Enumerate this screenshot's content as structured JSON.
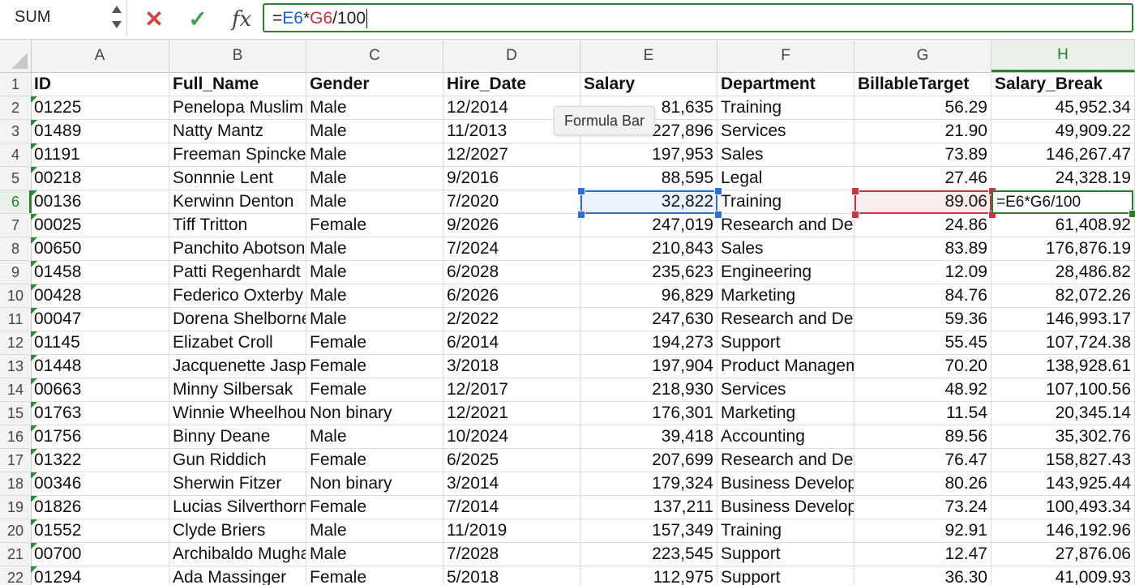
{
  "name_box": {
    "value": "SUM"
  },
  "formula_bar": {
    "cancel_glyph": "✕",
    "enter_glyph": "✓",
    "fx_label": "fx",
    "formula_parts": [
      {
        "text": "=",
        "ref": ""
      },
      {
        "text": "E6",
        "ref": "blue"
      },
      {
        "text": "*",
        "ref": ""
      },
      {
        "text": "G6",
        "ref": "red"
      },
      {
        "text": "/100",
        "ref": ""
      }
    ]
  },
  "tooltip": {
    "text": "Formula Bar"
  },
  "columns": [
    "A",
    "B",
    "C",
    "D",
    "E",
    "F",
    "G",
    "H"
  ],
  "active_column": "H",
  "active_row": 6,
  "header_row": [
    "ID",
    "Full_Name",
    "Gender",
    "Hire_Date",
    "Salary",
    "Department",
    "BillableTarget",
    "Salary_Break"
  ],
  "rows": [
    [
      "01225",
      "Penelopa Muslim",
      "Male",
      "12/2014",
      "81,635",
      "Training",
      "56.29",
      "45,952.34"
    ],
    [
      "01489",
      "Natty Mantz",
      "Male",
      "11/2013",
      "227,896",
      "Services",
      "21.90",
      "49,909.22"
    ],
    [
      "01191",
      "Freeman Spinckes",
      "Male",
      "12/2027",
      "197,953",
      "Sales",
      "73.89",
      "146,267.47"
    ],
    [
      "00218",
      "Sonnnie Lent",
      "Male",
      "9/2016",
      "88,595",
      "Legal",
      "27.46",
      "24,328.19"
    ],
    [
      "00136",
      "Kerwinn Denton",
      "Male",
      "7/2020",
      "32,822",
      "Training",
      "89.06",
      "=E6*G6/100"
    ],
    [
      "00025",
      "Tiff Tritton",
      "Female",
      "9/2026",
      "247,019",
      "Research and Development",
      "24.86",
      "61,408.92"
    ],
    [
      "00650",
      "Panchito Abotson",
      "Male",
      "7/2024",
      "210,843",
      "Sales",
      "83.89",
      "176,876.19"
    ],
    [
      "01458",
      "Patti Regenhardt",
      "Male",
      "6/2028",
      "235,623",
      "Engineering",
      "12.09",
      "28,486.82"
    ],
    [
      "00428",
      "Federico Oxterby",
      "Male",
      "6/2026",
      "96,829",
      "Marketing",
      "84.76",
      "82,072.26"
    ],
    [
      "00047",
      "Dorena Shelborne",
      "Male",
      "2/2022",
      "247,630",
      "Research and Development",
      "59.36",
      "146,993.17"
    ],
    [
      "01145",
      "Elizabet Croll",
      "Female",
      "6/2014",
      "194,273",
      "Support",
      "55.45",
      "107,724.38"
    ],
    [
      "01448",
      "Jacquenette Jaspar",
      "Female",
      "3/2018",
      "197,904",
      "Product Management",
      "70.20",
      "138,928.61"
    ],
    [
      "00663",
      "Minny Silbersak",
      "Female",
      "12/2017",
      "218,930",
      "Services",
      "48.92",
      "107,100.56"
    ],
    [
      "01763",
      "Winnie Wheelhouse",
      "Non binary",
      "12/2021",
      "176,301",
      "Marketing",
      "11.54",
      "20,345.14"
    ],
    [
      "01756",
      "Binny Deane",
      "Male",
      "10/2024",
      "39,418",
      "Accounting",
      "89.56",
      "35,302.76"
    ],
    [
      "01322",
      "Gun Riddich",
      "Female",
      "6/2025",
      "207,699",
      "Research and Development",
      "76.47",
      "158,827.43"
    ],
    [
      "00346",
      "Sherwin Fitzer",
      "Non binary",
      "3/2014",
      "179,324",
      "Business Development",
      "80.26",
      "143,925.44"
    ],
    [
      "01826",
      "Lucias Silverthorne",
      "Female",
      "7/2014",
      "137,211",
      "Business Development",
      "73.24",
      "100,493.34"
    ],
    [
      "01552",
      "Clyde Briers",
      "Male",
      "11/2019",
      "157,349",
      "Training",
      "92.91",
      "146,192.96"
    ],
    [
      "00700",
      "Archibaldo Mughal",
      "Male",
      "7/2028",
      "223,545",
      "Support",
      "12.47",
      "27,876.06"
    ],
    [
      "01294",
      "Ada Massinger",
      "Female",
      "5/2018",
      "112,975",
      "Support",
      "36.30",
      "41,009.93"
    ]
  ],
  "colors": {
    "accent_green": "#2e7d32",
    "ref_blue": "#2f6fd2",
    "ref_red": "#cc3345",
    "error_marker": "#2e8b3e"
  }
}
